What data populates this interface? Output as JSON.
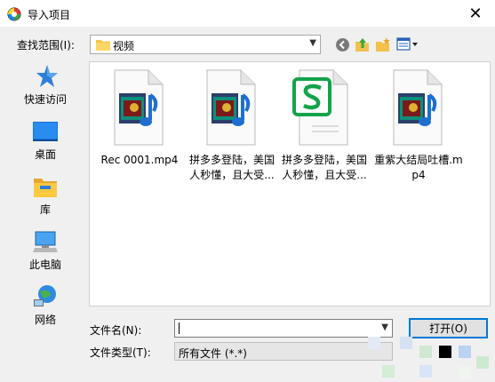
{
  "window": {
    "title": "导入项目",
    "close_glyph": "✕"
  },
  "toolbar": {
    "lookin_label": "查找范围(I):",
    "lookin_value": "视频",
    "tools": [
      {
        "name": "back-icon"
      },
      {
        "name": "up-folder-icon"
      },
      {
        "name": "new-folder-icon"
      },
      {
        "name": "view-menu-icon"
      }
    ]
  },
  "places": [
    {
      "label": "快速访问",
      "icon": "star-icon"
    },
    {
      "label": "桌面",
      "icon": "desktop-icon"
    },
    {
      "label": "库",
      "icon": "library-icon"
    },
    {
      "label": "此电脑",
      "icon": "computer-icon"
    },
    {
      "label": "网络",
      "icon": "network-icon"
    }
  ],
  "files": [
    {
      "name": "Rec 0001.mp4",
      "icon": "video-file-icon"
    },
    {
      "name": "拼多多登陆，美国人秒懂，且大受...",
      "icon": "video-file-icon"
    },
    {
      "name": "拼多多登陆，美国人秒懂，且大受...",
      "icon": "wps-document-icon"
    },
    {
      "name": "重紫大结局吐槽.mp4",
      "icon": "video-file-icon"
    }
  ],
  "bottom": {
    "filename_label": "文件名(N):",
    "filename_value": "",
    "filetype_label": "文件类型(T):",
    "filetype_value": "所有文件 (*.*)",
    "open_label": "打开(O)"
  },
  "colors": {
    "accent": "#0078d7",
    "wps_green": "#13a34a",
    "panel": "#f0f0f0"
  }
}
